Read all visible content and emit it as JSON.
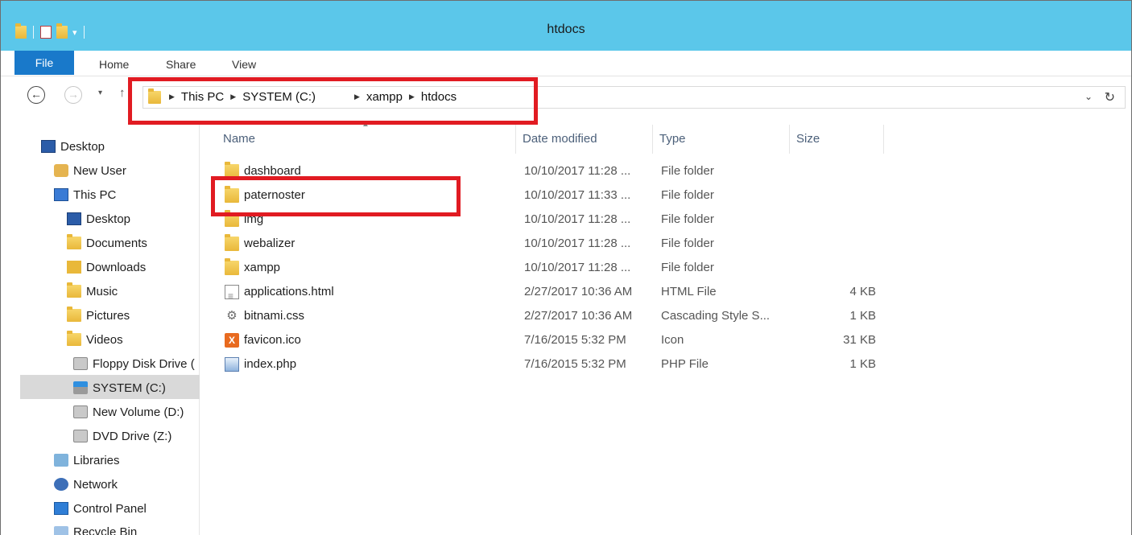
{
  "window": {
    "title": "htdocs",
    "quick_access": {
      "dropdown_glyph": "▾",
      "divider": "|"
    }
  },
  "ribbon": {
    "tabs": [
      {
        "label": "File"
      },
      {
        "label": "Home"
      },
      {
        "label": "Share"
      },
      {
        "label": "View"
      }
    ]
  },
  "address": {
    "back_glyph": "←",
    "forward_glyph": "→",
    "dropdown_glyph": "▾",
    "up_glyph": "↑",
    "breadcrumbs": [
      "This PC",
      "SYSTEM (C:)",
      "xampp",
      "htdocs"
    ],
    "chevron_glyph": "▶",
    "history_glyph": "⌄",
    "refresh_glyph": "↻"
  },
  "navigation": {
    "items": [
      {
        "label": "Desktop",
        "icon": "desktop-icon"
      },
      {
        "label": "New User",
        "icon": "user-folder-icon"
      },
      {
        "label": "This PC",
        "icon": "computer-icon"
      },
      {
        "label": "Desktop",
        "icon": "desktop-folder-icon"
      },
      {
        "label": "Documents",
        "icon": "documents-icon"
      },
      {
        "label": "Downloads",
        "icon": "downloads-icon"
      },
      {
        "label": "Music",
        "icon": "music-icon"
      },
      {
        "label": "Pictures",
        "icon": "pictures-icon"
      },
      {
        "label": "Videos",
        "icon": "videos-icon"
      },
      {
        "label": "Floppy Disk Drive (",
        "icon": "floppy-drive-icon"
      },
      {
        "label": "SYSTEM (C:)",
        "icon": "system-drive-icon",
        "selected": true
      },
      {
        "label": "New Volume (D:)",
        "icon": "drive-icon"
      },
      {
        "label": "DVD Drive (Z:)",
        "icon": "dvd-drive-icon"
      },
      {
        "label": "Libraries",
        "icon": "libraries-icon"
      },
      {
        "label": "Network",
        "icon": "network-icon"
      },
      {
        "label": "Control Panel",
        "icon": "control-panel-icon"
      },
      {
        "label": "Recycle Bin",
        "icon": "recycle-bin-icon"
      }
    ]
  },
  "columns": {
    "name": "Name",
    "date": "Date modified",
    "type": "Type",
    "size": "Size",
    "sort_glyph": "▲"
  },
  "files": [
    {
      "name": "dashboard",
      "date": "10/10/2017 11:28 ...",
      "type": "File folder",
      "size": "",
      "icon": "folder-icon"
    },
    {
      "name": "paternoster",
      "date": "10/10/2017 11:33 ...",
      "type": "File folder",
      "size": "",
      "icon": "folder-icon"
    },
    {
      "name": "img",
      "date": "10/10/2017 11:28 ...",
      "type": "File folder",
      "size": "",
      "icon": "folder-icon"
    },
    {
      "name": "webalizer",
      "date": "10/10/2017 11:28 ...",
      "type": "File folder",
      "size": "",
      "icon": "folder-icon"
    },
    {
      "name": "xampp",
      "date": "10/10/2017 11:28 ...",
      "type": "File folder",
      "size": "",
      "icon": "folder-icon"
    },
    {
      "name": "applications.html",
      "date": "2/27/2017 10:36 AM",
      "type": "HTML File",
      "size": "4 KB",
      "icon": "html-file-icon"
    },
    {
      "name": "bitnami.css",
      "date": "2/27/2017 10:36 AM",
      "type": "Cascading Style S...",
      "size": "1 KB",
      "icon": "css-file-icon"
    },
    {
      "name": "favicon.ico",
      "date": "7/16/2015 5:32 PM",
      "type": "Icon",
      "size": "31 KB",
      "icon": "xampp-icon"
    },
    {
      "name": "index.php",
      "date": "7/16/2015 5:32 PM",
      "type": "PHP File",
      "size": "1 KB",
      "icon": "php-file-icon"
    }
  ],
  "colors": {
    "titlebar": "#5bc7ea",
    "file_tab": "#1979ca",
    "highlight_box": "#e11b22",
    "selected_nav": "#d9d9d9"
  }
}
